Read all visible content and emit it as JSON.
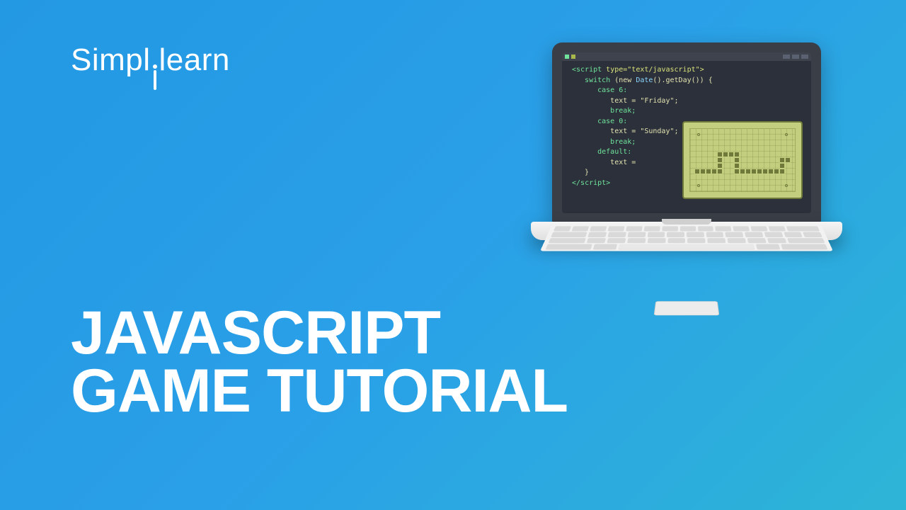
{
  "logo": {
    "part1": "Simpl",
    "part2": "learn"
  },
  "title": {
    "line1": "JAVASCRIPT",
    "line2": "GAME TUTORIAL"
  },
  "code": {
    "l1a": "<script",
    "l1b": " type",
    "l1c": "=\"text/javascript\">",
    "l2a": "   switch ",
    "l2b": "(new ",
    "l2c": "Date",
    "l2d": "().getDay()) {",
    "l3": "      case 6:",
    "l4": "         text = \"Friday\";",
    "l5": "         break;",
    "l6": "      case 0:",
    "l7": "         text = \"Sunday\";",
    "l8": "         break;",
    "l9": "      default:",
    "l10": "         text =",
    "l11": "   }",
    "end_open": "</",
    "end_name": "script",
    "end_close": ">"
  }
}
